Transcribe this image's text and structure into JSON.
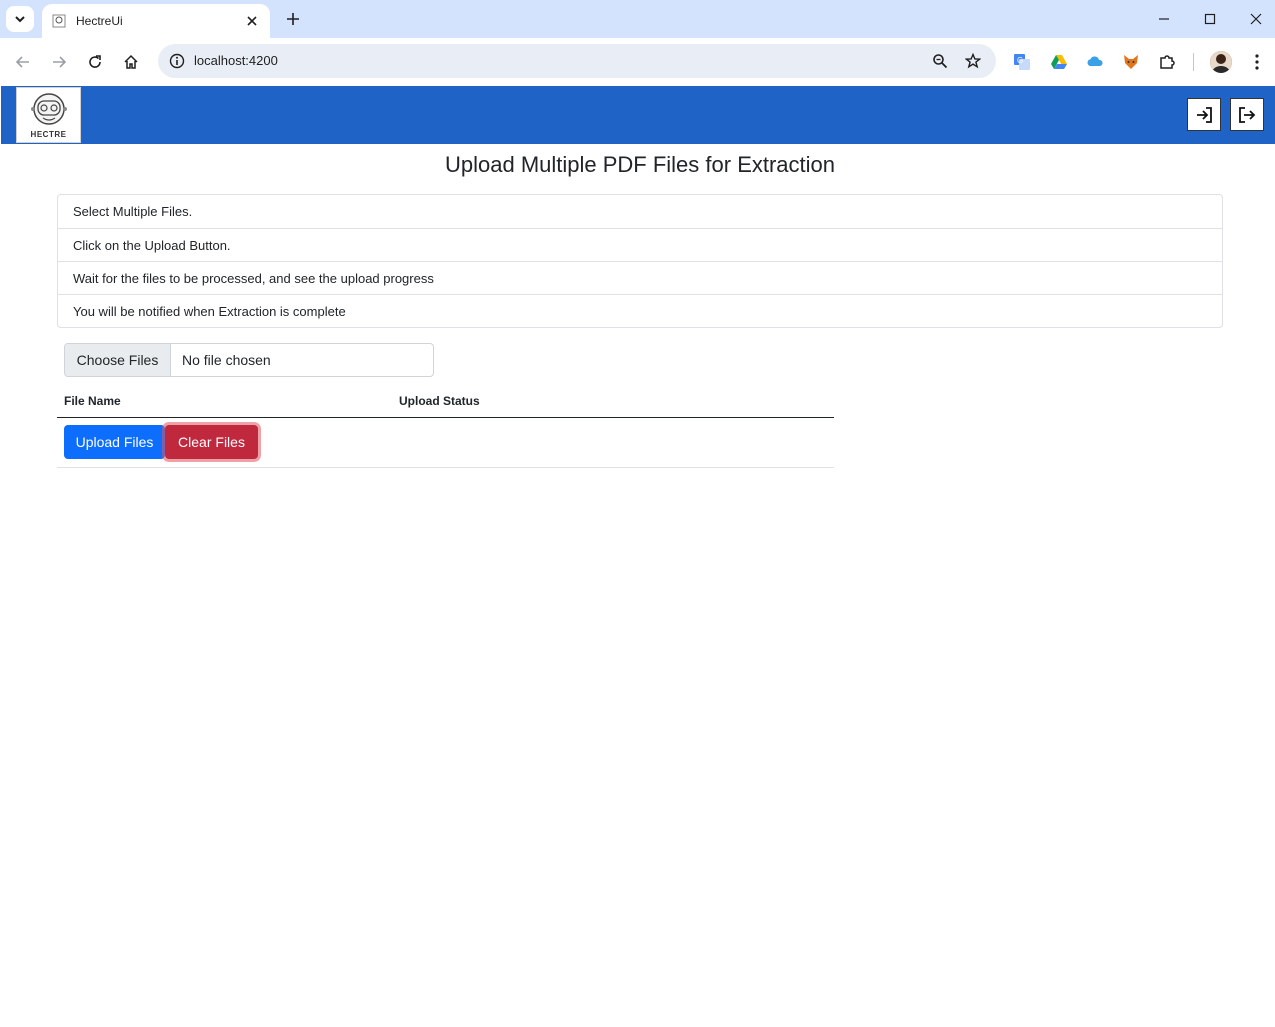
{
  "browser": {
    "tab_title": "HectreUi",
    "url": "localhost:4200",
    "icons": {
      "tab_search": "chevron-down-icon",
      "favicon": "hectre-favicon",
      "tab_close": "close-icon",
      "new_tab": "plus-icon",
      "minimize": "minimize-icon",
      "maximize": "maximize-icon",
      "close_window": "close-icon",
      "back": "back-arrow-icon",
      "forward": "forward-arrow-icon",
      "reload": "reload-icon",
      "home": "home-icon",
      "site_info": "info-icon",
      "zoom": "zoom-icon",
      "bookmark": "star-icon",
      "extensions": [
        "translate-icon",
        "drive-icon",
        "cloud-icon",
        "fox-icon",
        "puzzle-icon"
      ],
      "menu": "kebab-menu-icon"
    }
  },
  "navbar": {
    "logo_text": "HECTRE",
    "color": "#1f63c6",
    "login_icon": "login-icon",
    "logout_icon": "logout-icon"
  },
  "page": {
    "title": "Upload Multiple PDF Files for Extraction",
    "steps": [
      "Select Multiple Files.",
      "Click on the Upload Button.",
      "Wait for the files to be processed, and see the upload progress",
      "You will be notified when Extraction is complete"
    ],
    "file_input": {
      "button_label": "Choose Files",
      "status": "No file chosen"
    },
    "table": {
      "headers": [
        "File Name",
        "Upload Status"
      ]
    },
    "actions": {
      "upload_label": "Upload Files",
      "clear_label": "Clear Files",
      "upload_color": "#0d6efd",
      "clear_color": "#c0283d"
    }
  }
}
